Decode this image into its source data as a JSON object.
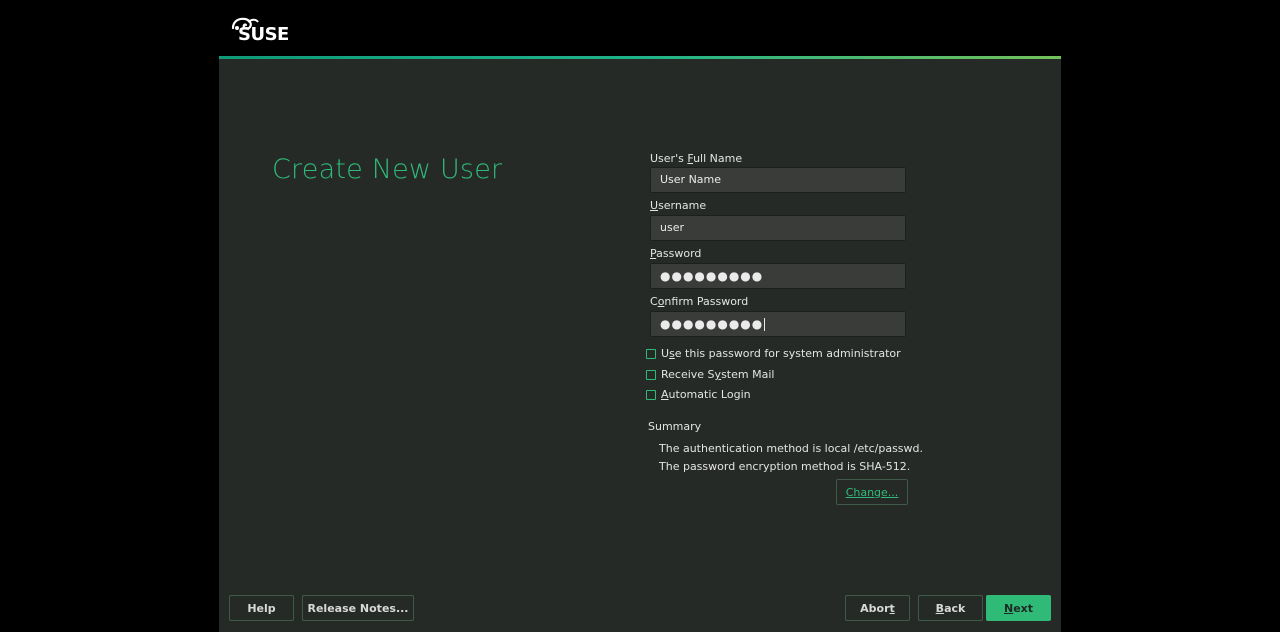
{
  "brand": {
    "logo_text": "SUSE",
    "accent_color": "#30ba78"
  },
  "page": {
    "title": "Create New User"
  },
  "form": {
    "full_name": {
      "label_pre": "User's ",
      "label_key": "F",
      "label_post": "ull Name",
      "value": "User Name"
    },
    "username": {
      "label_key": "U",
      "label_post": "sername",
      "value": "user"
    },
    "password": {
      "label_key": "P",
      "label_post": "assword",
      "value": "●●●●●●●●●"
    },
    "confirm_password": {
      "label_pre": "C",
      "label_key": "o",
      "label_post": "nfirm Password",
      "value": "●●●●●●●●●"
    }
  },
  "options": [
    {
      "pre": "U",
      "key": "s",
      "post": "e this password for system administrator",
      "checked": false
    },
    {
      "pre": "Receive S",
      "key": "y",
      "post": "stem Mail",
      "checked": false
    },
    {
      "pre": "",
      "key": "A",
      "post": "utomatic Login",
      "checked": false
    }
  ],
  "summary": {
    "label": "Summary",
    "lines": [
      "The authentication method is local /etc/passwd.",
      "The password encryption method is SHA-512."
    ],
    "change_key": "C",
    "change_post": "hange..."
  },
  "footer": {
    "help": "Help",
    "release_notes": "Release Notes...",
    "abort_pre": "Abor",
    "abort_key": "t",
    "back_key": "B",
    "back_post": "ack",
    "next_key": "N",
    "next_post": "ext"
  }
}
